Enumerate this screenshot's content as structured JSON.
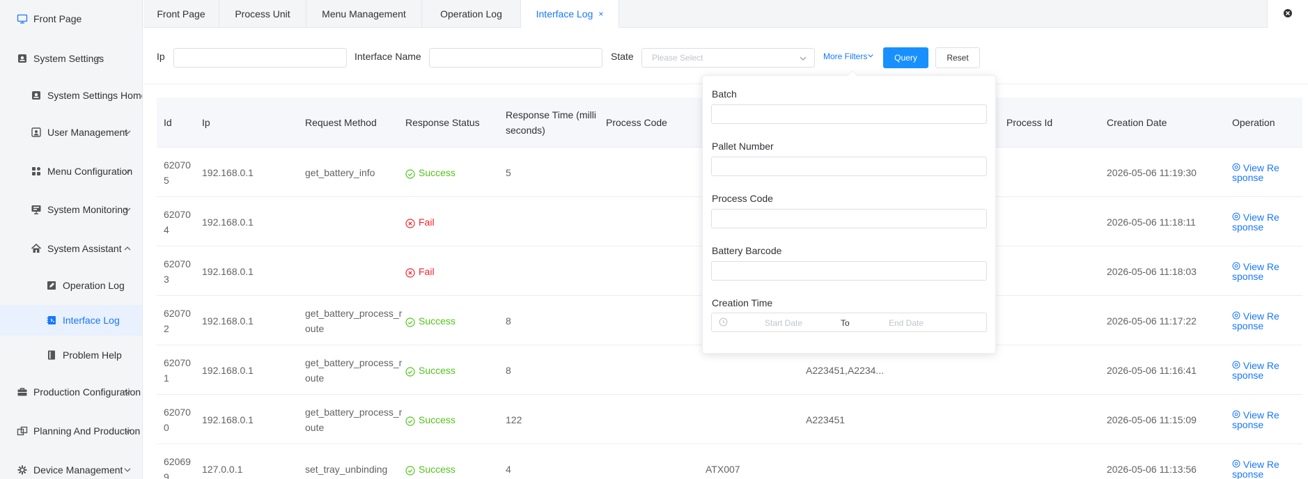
{
  "sidebar": {
    "items": [
      {
        "label": "Front Page",
        "icon": "monitor-icon"
      },
      {
        "label": "System Settings",
        "icon": "settings-icon"
      },
      {
        "label": "System Settings Home",
        "icon": "settings-home-icon"
      },
      {
        "label": "User Management",
        "icon": "user-icon"
      },
      {
        "label": "Menu Configuration",
        "icon": "grid-icon"
      },
      {
        "label": "System Monitoring",
        "icon": "monitoring-icon"
      },
      {
        "label": "System Assistant",
        "icon": "home-icon"
      },
      {
        "label": "Operation Log",
        "icon": "edit-log-icon"
      },
      {
        "label": "Interface Log",
        "icon": "interface-log-icon"
      },
      {
        "label": "Problem Help",
        "icon": "book-icon"
      },
      {
        "label": "Production Configuration",
        "icon": "briefcase-icon"
      },
      {
        "label": "Planning And Production",
        "icon": "planning-icon"
      },
      {
        "label": "Device Management",
        "icon": "gear-icon"
      }
    ]
  },
  "tabs": [
    {
      "label": "Front Page"
    },
    {
      "label": "Process Unit"
    },
    {
      "label": "Menu Management"
    },
    {
      "label": "Operation Log"
    },
    {
      "label": "Interface Log"
    }
  ],
  "active_tab_close": "×",
  "filters": {
    "ip_label": "Ip",
    "ip_value": "",
    "interface_label": "Interface Name",
    "interface_value": "",
    "state_label": "State",
    "state_placeholder": "Please Select",
    "more_filters": "More Filters",
    "query": "Query",
    "reset": "Reset"
  },
  "popover": {
    "batch_label": "Batch",
    "pallet_label": "Pallet Number",
    "process_code_label": "Process Code",
    "battery_barcode_label": "Battery Barcode",
    "creation_time_label": "Creation Time",
    "start_date": "Start Date",
    "range_separator": "To",
    "end_date": "End Date"
  },
  "table": {
    "headers": {
      "id": "Id",
      "ip": "Ip",
      "method": "Request Method",
      "status": "Response Status",
      "time": "Response Time (milliseconds)",
      "process_code": "Process Code",
      "process_id": "Process Id",
      "creation_date": "Creation Date",
      "operation": "Operation"
    },
    "view_response": "View Response",
    "rows": [
      {
        "id": "620705",
        "ip": "192.168.0.1",
        "method": "get_battery_info",
        "status": "Success",
        "ok": true,
        "time": "5",
        "code": "",
        "barcode": "",
        "date": "2026-05-06 11:19:30"
      },
      {
        "id": "620704",
        "ip": "192.168.0.1",
        "method": "",
        "status": "Fail",
        "ok": false,
        "time": "",
        "code": "",
        "barcode": "",
        "date": "2026-05-06 11:18:11"
      },
      {
        "id": "620703",
        "ip": "192.168.0.1",
        "method": "",
        "status": "Fail",
        "ok": false,
        "time": "",
        "code": "",
        "barcode": "",
        "date": "2026-05-06 11:18:03"
      },
      {
        "id": "620702",
        "ip": "192.168.0.1",
        "method": "get_battery_process_route",
        "status": "Success",
        "ok": true,
        "time": "8",
        "code": "",
        "barcode": "",
        "date": "2026-05-06 11:17:22"
      },
      {
        "id": "620701",
        "ip": "192.168.0.1",
        "method": "get_battery_process_route",
        "status": "Success",
        "ok": true,
        "time": "8",
        "code": "",
        "barcode": "A223451,A2234...",
        "date": "2026-05-06 11:16:41"
      },
      {
        "id": "620700",
        "ip": "192.168.0.1",
        "method": "get_battery_process_route",
        "status": "Success",
        "ok": true,
        "time": "122",
        "code": "",
        "barcode": "A223451",
        "date": "2026-05-06 11:15:09"
      },
      {
        "id": "620699",
        "ip": "127.0.0.1",
        "method": "set_tray_unbinding",
        "status": "Success",
        "ok": true,
        "time": "4",
        "code": "ATX007",
        "barcode": "",
        "date": "2026-05-06 11:13:56"
      }
    ]
  }
}
